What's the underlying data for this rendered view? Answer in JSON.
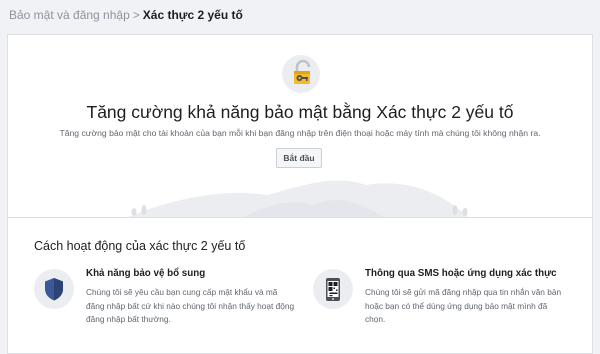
{
  "breadcrumb": {
    "parent": "Bảo mật và đăng nhập",
    "separator": ">",
    "current": "Xác thực 2 yếu tố"
  },
  "hero": {
    "icon": "padlock-with-key-icon",
    "title": "Tăng cường khả năng bảo mật bằng Xác thực 2 yếu tố",
    "subtitle": "Tăng cường bảo mật cho tài khoản của bạn mỗi khi bạn đăng nhập trên điện thoại hoặc máy tính mà chúng tôi không nhận ra.",
    "start_button": "Bắt đầu"
  },
  "how": {
    "title": "Cách hoạt động của xác thực 2 yếu tố",
    "features": [
      {
        "icon": "shield-icon",
        "title": "Khả năng bảo vệ bổ sung",
        "desc_lines": [
          "Chúng tôi sẽ yêu cầu bạn cung cấp mật khẩu và mã",
          "đăng nhập bất cứ khi nào chúng tôi nhận thấy hoạt động",
          "đăng nhập bất thường."
        ]
      },
      {
        "icon": "phone-qr-code-icon",
        "title": "Thông qua SMS hoặc ứng dụng xác thực",
        "desc_lines": [
          "Chúng tôi sẽ gửi mã đăng nhập qua tin nhắn văn bản",
          "hoặc bạn có thể dùng ứng dụng bảo mật mình đã",
          "chọn."
        ]
      }
    ]
  },
  "colors": {
    "page_bg": "#f0f2f5",
    "card_bg": "#ffffff",
    "shield_blue": "#3b5998",
    "lock_gold": "#f7b928"
  }
}
